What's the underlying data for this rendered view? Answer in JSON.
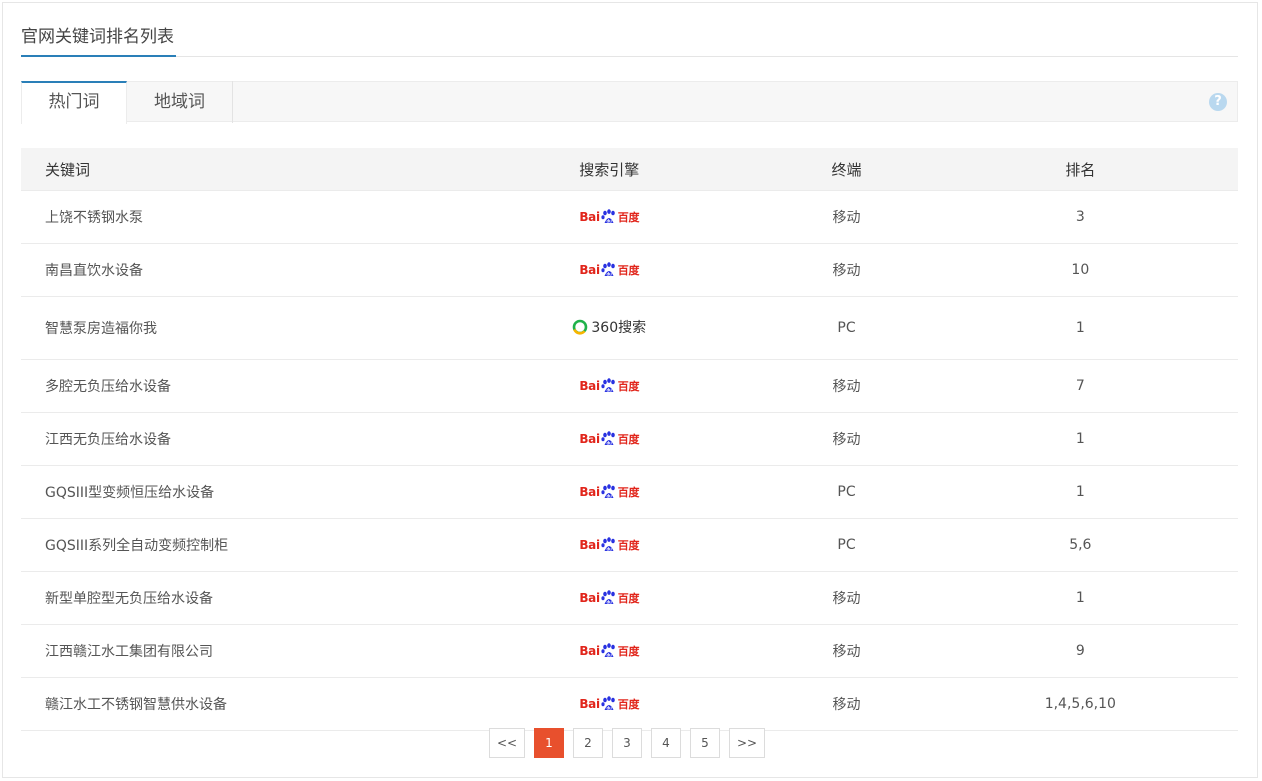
{
  "page": {
    "title": "官网关键词排名列表"
  },
  "tabs": [
    {
      "label": "热门词",
      "active": true
    },
    {
      "label": "地域词",
      "active": false
    }
  ],
  "help": {
    "glyph": "?"
  },
  "table": {
    "columns": [
      "关键词",
      "搜索引擎",
      "终端",
      "排名"
    ],
    "rows": [
      {
        "keyword": "上饶不锈钢水泵",
        "engine": "baidu",
        "terminal": "移动",
        "rank": "3"
      },
      {
        "keyword": "南昌直饮水设备",
        "engine": "baidu",
        "terminal": "移动",
        "rank": "10"
      },
      {
        "keyword": "智慧泵房造福你我",
        "engine": "360",
        "terminal": "PC",
        "rank": "1"
      },
      {
        "keyword": "多腔无负压给水设备",
        "engine": "baidu",
        "terminal": "移动",
        "rank": "7"
      },
      {
        "keyword": "江西无负压给水设备",
        "engine": "baidu",
        "terminal": "移动",
        "rank": "1"
      },
      {
        "keyword": "GQSIII型变频恒压给水设备",
        "engine": "baidu",
        "terminal": "PC",
        "rank": "1"
      },
      {
        "keyword": "GQSIII系列全自动变频控制柜",
        "engine": "baidu",
        "terminal": "PC",
        "rank": "5,6"
      },
      {
        "keyword": "新型单腔型无负压给水设备",
        "engine": "baidu",
        "terminal": "移动",
        "rank": "1"
      },
      {
        "keyword": "江西赣江水工集团有限公司",
        "engine": "baidu",
        "terminal": "移动",
        "rank": "9"
      },
      {
        "keyword": "赣江水工不锈钢智慧供水设备",
        "engine": "baidu",
        "terminal": "移动",
        "rank": "1,4,5,6,10"
      }
    ]
  },
  "engines": {
    "baidu": {
      "text_a": "Bai",
      "text_b": "百度",
      "paw_text": "du",
      "color": "#e1251b",
      "paw_color": "#2932e1"
    },
    "360": {
      "text": "360搜索",
      "ring_colors": [
        "#1fb24a",
        "#f7b500"
      ]
    }
  },
  "pagination": {
    "prev": "<<",
    "pages": [
      "1",
      "2",
      "3",
      "4",
      "5"
    ],
    "current": "1",
    "next": ">>",
    "accent": "#e8502d"
  }
}
